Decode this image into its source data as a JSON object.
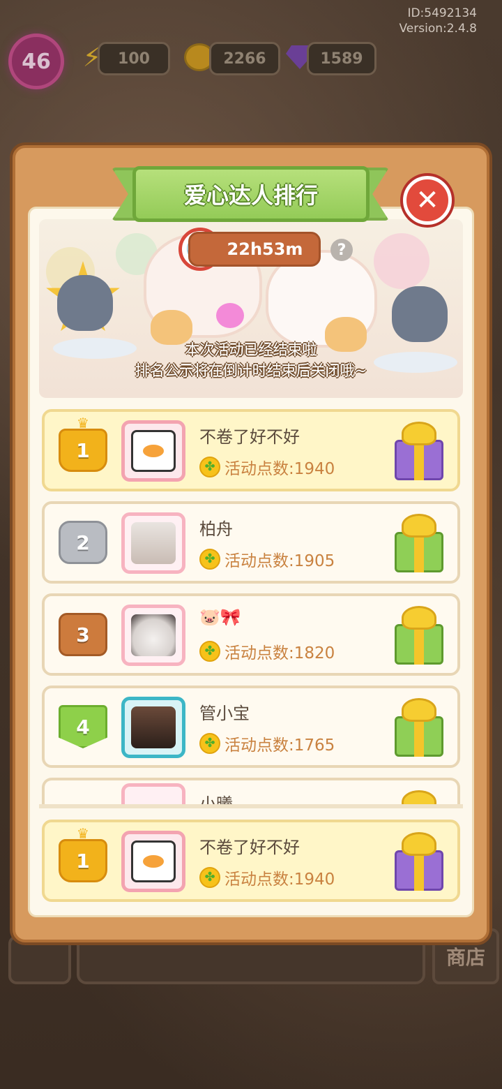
{
  "hud": {
    "id_text": "ID:5492134",
    "version_text": "Version:2.4.8",
    "level": "46",
    "energy": "100",
    "coins": "2266",
    "gems": "1589",
    "energy_icon": "lightning-icon",
    "coin_icon": "coin-icon",
    "gem_icon": "gem-icon"
  },
  "background": {
    "shop_label": "商店"
  },
  "panel": {
    "title": "爱心达人排行",
    "close_icon": "close-icon",
    "timer": "22h53m",
    "help_symbol": "?",
    "notice_line1": "本次活动已经结束啦",
    "notice_line2": "排名公示将在倒计时结束后关闭哦~"
  },
  "score_label_prefix": "活动点数:",
  "ranks": [
    {
      "rank": "1",
      "name": "不卷了好不好",
      "score": "活动点数:1940",
      "gift": "purple"
    },
    {
      "rank": "2",
      "name": "柏舟",
      "score": "活动点数:1905",
      "gift": "green"
    },
    {
      "rank": "3",
      "name": "🐷🎀",
      "score": "活动点数:1820",
      "gift": "green"
    },
    {
      "rank": "4",
      "name": "管小宝",
      "score": "活动点数:1765",
      "gift": "green"
    },
    {
      "rank": "",
      "name": "小曦",
      "score": "",
      "gift": "gold"
    }
  ],
  "self_rank": {
    "rank": "1",
    "name": "不卷了好不好",
    "score": "活动点数:1940",
    "gift": "purple"
  },
  "colors": {
    "panel": "#d79a5e",
    "title_green": "#94cb58",
    "gold_row": "#fff6c8",
    "score_text": "#c98240"
  }
}
